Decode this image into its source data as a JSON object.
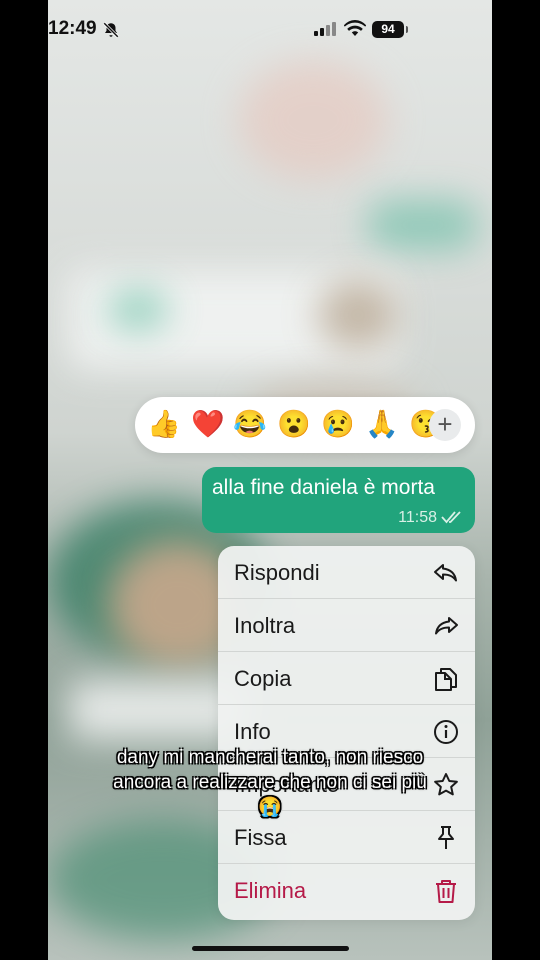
{
  "status_bar": {
    "time": "12:49",
    "battery": "94",
    "icons": [
      "bell-slash-icon",
      "signal-icon",
      "wifi-icon",
      "battery-icon"
    ]
  },
  "reactions": {
    "emojis": [
      "👍",
      "❤️",
      "😂",
      "😮",
      "😢",
      "🙏",
      "😘"
    ],
    "more_icon": "plus-icon",
    "more_label": "+"
  },
  "message": {
    "text": "alla fine daniela è morta",
    "time": "11:58",
    "status_icon": "double-check-icon",
    "bubble_color": "#21a47c"
  },
  "menu": {
    "items": [
      {
        "label": "Rispondi",
        "icon": "reply-icon"
      },
      {
        "label": "Inoltra",
        "icon": "forward-icon"
      },
      {
        "label": "Copia",
        "icon": "copy-icon"
      },
      {
        "label": "Info",
        "icon": "info-icon"
      },
      {
        "label": "Importante",
        "icon": "star-icon"
      },
      {
        "label": "Fissa",
        "icon": "pin-icon"
      },
      {
        "label": "Elimina",
        "icon": "trash-icon"
      }
    ],
    "danger_color": "#b51a48"
  },
  "caption": {
    "text": "dany mi mancherai tanto, non riesco ancora a realizzare che non ci sei più😭"
  }
}
